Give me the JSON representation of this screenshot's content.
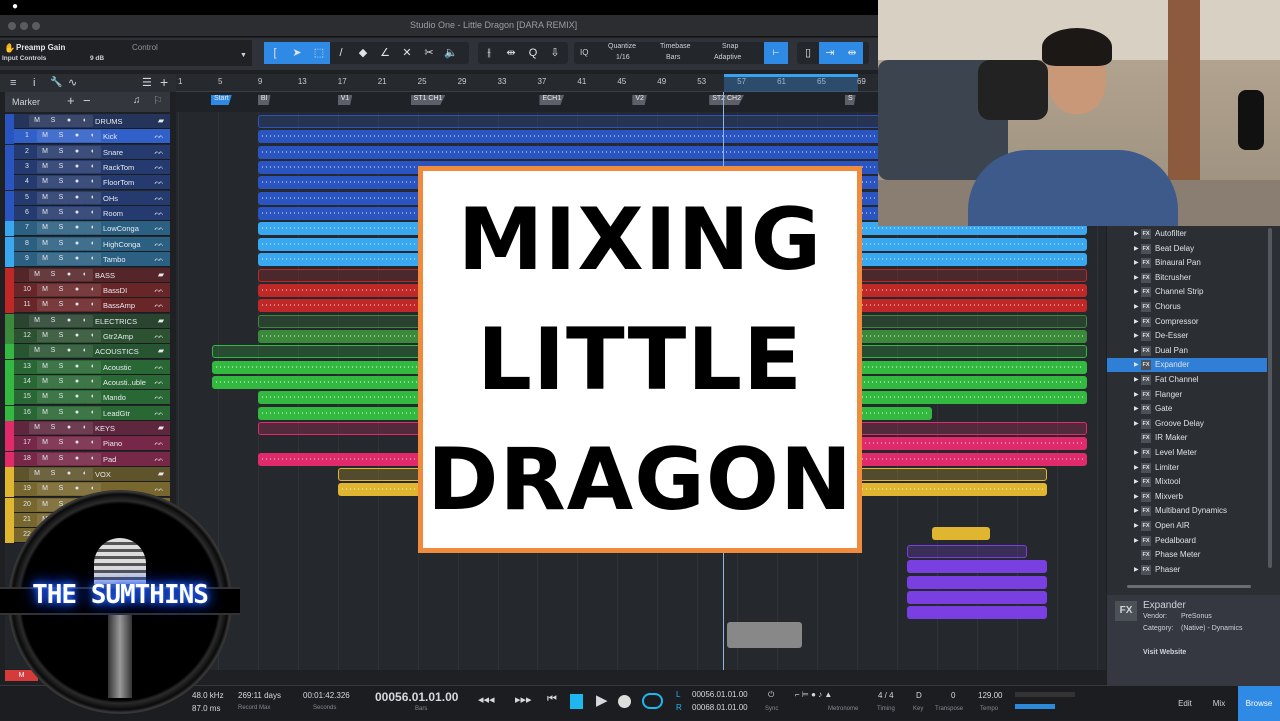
{
  "window": {
    "title": "Studio One - Little Dragon [DARA REMIX]"
  },
  "inspector": {
    "param": "Preamp Gain",
    "control_label": "Control",
    "group": "Input Controls",
    "value": "9 dB"
  },
  "toolbar": {
    "quantize_label": "Quantize",
    "quantize_value": "1/16",
    "timebase_label": "Timebase",
    "timebase_value": "Bars",
    "snap_label": "Snap",
    "snap_value": "Adaptive",
    "iq": "IQ"
  },
  "ruler": {
    "bars": [
      "1",
      "5",
      "9",
      "13",
      "17",
      "21",
      "25",
      "29",
      "33",
      "37",
      "41",
      "45",
      "49",
      "53",
      "57",
      "61",
      "65",
      "69"
    ]
  },
  "markers": {
    "label": "Marker",
    "items": [
      {
        "name": "Start",
        "bar": 4.3
      },
      {
        "name": "BI",
        "bar": 9
      },
      {
        "name": "V1",
        "bar": 17
      },
      {
        "name": "ST1 CH1",
        "bar": 24.3
      },
      {
        "name": "ECH1",
        "bar": 37.2
      },
      {
        "name": "V2",
        "bar": 46.5
      },
      {
        "name": "ST2 CH2",
        "bar": 54.2
      },
      {
        "name": "S",
        "bar": 67.8
      }
    ]
  },
  "tracks": [
    {
      "type": "folder",
      "name": "DRUMS",
      "color": "#2a55c0"
    },
    {
      "num": "1",
      "name": "Kick",
      "color": "#2a55c0",
      "selected": true
    },
    {
      "num": "2",
      "name": "Snare",
      "color": "#2a55c0"
    },
    {
      "num": "3",
      "name": "RackTom",
      "color": "#2a55c0"
    },
    {
      "num": "4",
      "name": "FloorTom",
      "color": "#2a55c0"
    },
    {
      "num": "5",
      "name": "OHs",
      "color": "#2a55c0"
    },
    {
      "num": "6",
      "name": "Room",
      "color": "#2a55c0"
    },
    {
      "num": "7",
      "name": "LowConga",
      "color": "#3aa8f0"
    },
    {
      "num": "8",
      "name": "HighConga",
      "color": "#3aa8f0"
    },
    {
      "num": "9",
      "name": "Tambo",
      "color": "#3aa8f0"
    },
    {
      "type": "folder",
      "name": "BASS",
      "color": "#c02828"
    },
    {
      "num": "10",
      "name": "BassDI",
      "color": "#c02828"
    },
    {
      "num": "11",
      "name": "BassAmp",
      "color": "#c02828"
    },
    {
      "type": "folder",
      "name": "ELECTRICS",
      "color": "#3b8a3b"
    },
    {
      "num": "12",
      "name": "Gtr2Amp",
      "color": "#3b8a3b"
    },
    {
      "type": "folder",
      "name": "ACOUSTICS",
      "color": "#33b840"
    },
    {
      "num": "13",
      "name": "Acoustic",
      "color": "#33b840"
    },
    {
      "num": "14",
      "name": "Acousti..uble",
      "color": "#33b840"
    },
    {
      "num": "15",
      "name": "Mando",
      "color": "#33b840"
    },
    {
      "num": "16",
      "name": "LeadGtr",
      "color": "#33b840"
    },
    {
      "type": "folder",
      "name": "KEYS",
      "color": "#e02a6a"
    },
    {
      "num": "17",
      "name": "Piano",
      "color": "#e02a6a"
    },
    {
      "num": "18",
      "name": "Pad",
      "color": "#e02a6a"
    },
    {
      "type": "folder",
      "name": "VOX",
      "color": "#e0b530"
    },
    {
      "num": "19",
      "name": "",
      "color": "#e0b530"
    },
    {
      "num": "20",
      "name": "",
      "color": "#e0b530"
    },
    {
      "num": "21",
      "name": "",
      "color": "#e0b530"
    },
    {
      "num": "22",
      "name": "",
      "color": "#e0b530"
    }
  ],
  "track_buttons": {
    "mute": "M",
    "solo": "S"
  },
  "master_mute": "M",
  "browser": {
    "items": [
      {
        "name": "Autofilter",
        "exp": true
      },
      {
        "name": "Beat Delay",
        "exp": true
      },
      {
        "name": "Binaural Pan",
        "exp": true
      },
      {
        "name": "Bitcrusher",
        "exp": true
      },
      {
        "name": "Channel Strip",
        "exp": true
      },
      {
        "name": "Chorus",
        "exp": true
      },
      {
        "name": "Compressor",
        "exp": true
      },
      {
        "name": "De-Esser",
        "exp": true
      },
      {
        "name": "Dual Pan",
        "exp": true
      },
      {
        "name": "Expander",
        "exp": true,
        "selected": true
      },
      {
        "name": "Fat Channel",
        "exp": true
      },
      {
        "name": "Flanger",
        "exp": true
      },
      {
        "name": "Gate",
        "exp": true
      },
      {
        "name": "Groove Delay",
        "exp": true
      },
      {
        "name": "IR Maker",
        "exp": false
      },
      {
        "name": "Level Meter",
        "exp": true
      },
      {
        "name": "Limiter",
        "exp": true
      },
      {
        "name": "Mixtool",
        "exp": true
      },
      {
        "name": "Mixverb",
        "exp": true
      },
      {
        "name": "Multiband Dynamics",
        "exp": true
      },
      {
        "name": "Open AIR",
        "exp": true
      },
      {
        "name": "Pedalboard",
        "exp": true
      },
      {
        "name": "Phase Meter",
        "exp": false
      },
      {
        "name": "Phaser",
        "exp": true
      }
    ],
    "fx_badge": "FX",
    "info": {
      "name": "Expander",
      "vendor_label": "Vendor:",
      "vendor": "PreSonus",
      "category_label": "Category:",
      "category": "(Native) - Dynamics",
      "link": "Visit Website"
    }
  },
  "transport": {
    "sample_rate": "48.0 kHz",
    "latency": "87.0 ms",
    "record_max": "269:11 days",
    "record_max_label": "Record Max",
    "seconds": "00:01:42.326",
    "seconds_label": "Seconds",
    "bars": "00056.01.01.00",
    "bars_label": "Bars",
    "loop_l": "00056.01.01.00",
    "loop_r": "00068.01.01.00",
    "l": "L",
    "r": "R",
    "sync_label": "Sync",
    "metronome_label": "Metronome",
    "timing": "4 / 4",
    "timing_label": "Timing",
    "key": "D",
    "key_label": "Key",
    "transpose": "0",
    "transpose_label": "Transpose",
    "tempo": "129.00",
    "tempo_label": "Tempo"
  },
  "views": {
    "edit": "Edit",
    "mix": "Mix",
    "browse": "Browse"
  },
  "overlay": {
    "line1": "MIXING",
    "line2": "LITTLE",
    "line3": "DRAGON"
  },
  "logo": {
    "text": "THE SUMTHINS"
  }
}
